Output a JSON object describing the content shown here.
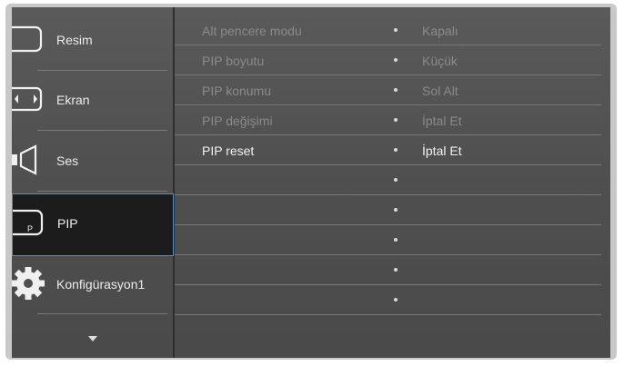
{
  "sidebar": {
    "items": [
      {
        "label": "Resim",
        "icon": "picture-icon"
      },
      {
        "label": "Ekran",
        "icon": "screen-icon"
      },
      {
        "label": "Ses",
        "icon": "speaker-icon"
      },
      {
        "label": "PIP",
        "icon": "pip-icon",
        "icon_text": "P",
        "active": true
      },
      {
        "label": "Konfigürasyon1",
        "icon": "gear-icon"
      }
    ],
    "scroll_icon": "chevron-down-icon"
  },
  "menu": {
    "rows": [
      {
        "name": "Alt pencere modu",
        "value": "Kapalı",
        "enabled": false
      },
      {
        "name": "PIP boyutu",
        "value": "Küçük",
        "enabled": false
      },
      {
        "name": "PIP konumu",
        "value": "Sol Alt",
        "enabled": false
      },
      {
        "name": "PIP değişimi",
        "value": "İptal Et",
        "enabled": false
      },
      {
        "name": "PIP reset",
        "value": "İptal Et",
        "enabled": true
      },
      {
        "name": "",
        "value": ""
      },
      {
        "name": "",
        "value": ""
      },
      {
        "name": "",
        "value": ""
      },
      {
        "name": "",
        "value": ""
      },
      {
        "name": "",
        "value": ""
      }
    ]
  },
  "colors": {
    "background": "#545454",
    "active_item_bg": "#1c1c1c",
    "active_border": "#4d90cc",
    "text_enabled": "#f2f2f2",
    "text_disabled": "#8a8a8a"
  }
}
